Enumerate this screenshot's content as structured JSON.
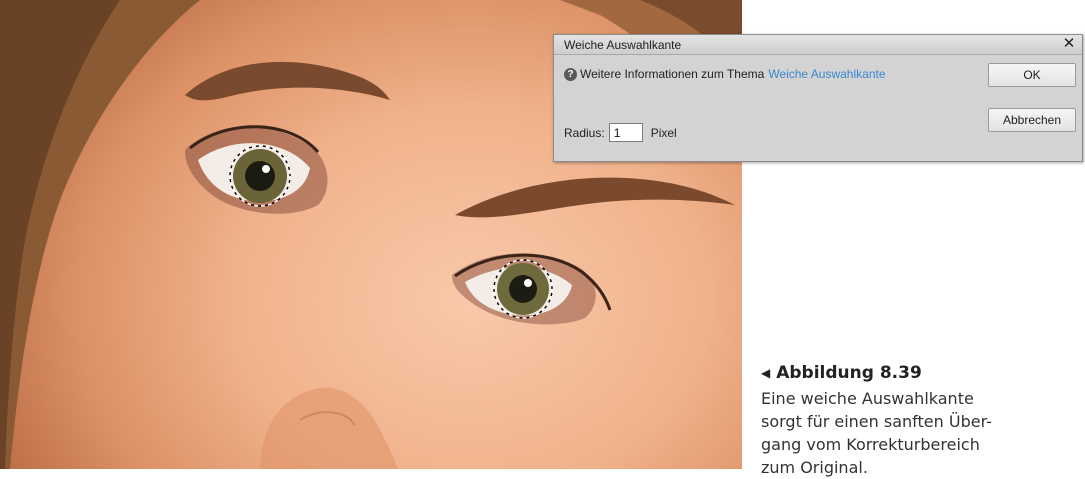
{
  "dialog": {
    "title": "Weiche Auswahlkante",
    "close_icon": "close-icon",
    "info_prefix": "Weitere Informationen zum Thema",
    "info_link": "Weiche Auswahlkante",
    "help_icon": "help-icon",
    "ok_label": "OK",
    "cancel_label": "Abbrechen",
    "radius_label": "Radius:",
    "radius_value": "1",
    "unit_label": "Pixel"
  },
  "caption": {
    "title": "Abbildung 8.39",
    "line1": "Eine weiche Auswahlkante",
    "line2": "sorgt für einen sanften Über-",
    "line3": "gang vom Korrekturbereich",
    "line4": "zum Original."
  },
  "colors": {
    "link": "#3a86d0",
    "dialog_bg": "#d3d3d3",
    "skin": "#f0b28c"
  }
}
